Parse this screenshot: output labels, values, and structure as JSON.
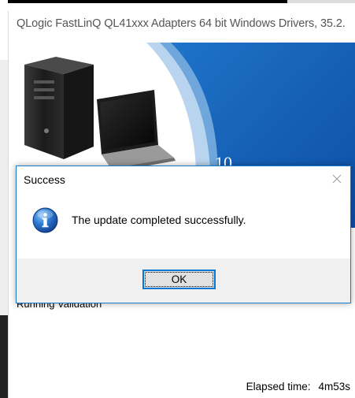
{
  "installer": {
    "title": "QLogic FastLinQ QL41xxx Adapters 64 bit Windows Drivers, 35.2.",
    "banner_text": "10.",
    "status_text": "Running Validation",
    "elapsed_label": "Elapsed time:",
    "elapsed_value": "4m53s"
  },
  "dialog": {
    "title": "Success",
    "message": "The update completed successfully.",
    "ok_label": "OK"
  },
  "colors": {
    "accent": "#0078d7",
    "dialog_border": "#1979ca",
    "banner_blue": "#1565c0",
    "footer_bg": "#f0f0f0"
  },
  "icons": {
    "dialog_icon": "info-icon",
    "close": "close-icon"
  }
}
